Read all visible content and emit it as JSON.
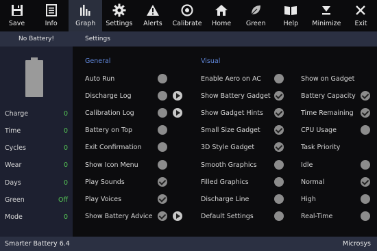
{
  "toolbar": {
    "items": [
      {
        "label": "Save",
        "icon": "save-icon"
      },
      {
        "label": "Info",
        "icon": "info-icon"
      },
      {
        "label": "Graph",
        "icon": "graph-icon"
      },
      {
        "label": "Settings",
        "icon": "gear-icon"
      },
      {
        "label": "Alerts",
        "icon": "warning-icon"
      },
      {
        "label": "Calibrate",
        "icon": "target-icon"
      },
      {
        "label": "Home",
        "icon": "home-icon"
      },
      {
        "label": "Green",
        "icon": "leaf-icon"
      },
      {
        "label": "Help",
        "icon": "book-icon"
      },
      {
        "label": "Minimize",
        "icon": "minimize-icon"
      },
      {
        "label": "Exit",
        "icon": "close-icon"
      }
    ],
    "active": "Graph"
  },
  "header": {
    "battery_status": "No Battery!",
    "section_title": "Settings"
  },
  "side": {
    "stats": [
      {
        "label": "Charge",
        "value": "0"
      },
      {
        "label": "Time",
        "value": "0"
      },
      {
        "label": "Cycles",
        "value": "0"
      },
      {
        "label": "Wear",
        "value": "0"
      },
      {
        "label": "Days",
        "value": "0"
      },
      {
        "label": "Green",
        "value": "Off"
      },
      {
        "label": "Mode",
        "value": "0"
      }
    ]
  },
  "general": {
    "title": "General",
    "items": [
      {
        "label": "Auto Run",
        "on": false
      },
      {
        "label": "Discharge Log",
        "on": false,
        "play": true
      },
      {
        "label": "Calibration Log",
        "on": false,
        "play": true
      },
      {
        "label": "Battery on Top",
        "on": false
      },
      {
        "label": "Exit Confirmation",
        "on": false
      },
      {
        "label": "Show Icon Menu",
        "on": false
      },
      {
        "label": "Play Sounds",
        "on": true
      },
      {
        "label": "Play Voices",
        "on": true
      },
      {
        "label": "Show Battery Advice",
        "on": true,
        "play": true
      }
    ]
  },
  "visual": {
    "title": "Visual",
    "items": [
      {
        "label": "Enable Aero on AC",
        "on": false
      },
      {
        "label": "Show Battery Gadget",
        "on": true
      },
      {
        "label": "Show Gadget Hints",
        "on": true
      },
      {
        "label": "Small Size Gadget",
        "on": true
      },
      {
        "label": "3D Style Gadget",
        "on": true
      },
      {
        "label": "Smooth Graphics",
        "on": false
      },
      {
        "label": "Filled Graphics",
        "on": false
      },
      {
        "label": "Discharge Line",
        "on": false
      },
      {
        "label": "Default Settings",
        "on": false
      }
    ]
  },
  "gadget": {
    "items": [
      {
        "label": "Show on Gadget",
        "toggle": false
      },
      {
        "label": "Battery Capacity",
        "toggle": true,
        "on": true
      },
      {
        "label": "Time Remaining",
        "toggle": true,
        "on": true
      },
      {
        "label": "CPU Usage",
        "toggle": true,
        "on": false
      },
      {
        "label": "Task Priority",
        "toggle": false
      },
      {
        "label": "Idle",
        "toggle": true,
        "on": false
      },
      {
        "label": "Normal",
        "toggle": true,
        "on": true
      },
      {
        "label": "High",
        "toggle": true,
        "on": false
      },
      {
        "label": "Real-Time",
        "toggle": true,
        "on": false
      }
    ]
  },
  "status": {
    "left": "Smarter Battery 6.4",
    "right": "Microsys"
  },
  "colors": {
    "accent": "#5f86d8",
    "panel": "#2b3042",
    "value_green": "#55c755"
  }
}
